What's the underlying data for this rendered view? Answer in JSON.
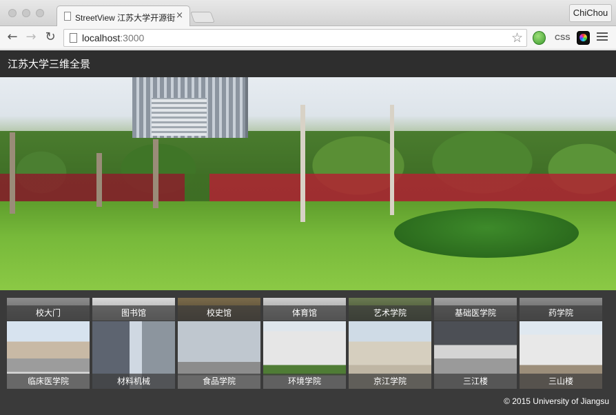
{
  "browser": {
    "tab_title": "StreetView 江苏大学开源街景",
    "tab_close": "×",
    "profile_name": "ChiChou",
    "url_host": "localhost",
    "url_port": ":3000",
    "back_glyph": "←",
    "forward_glyph": "→",
    "reload_glyph": "↻",
    "bookmark_glyph": "☆",
    "ext_css_label": "CSS"
  },
  "site": {
    "title": "江苏大学三维全景"
  },
  "locations": {
    "row1": [
      "校大门",
      "图书馆",
      "校史馆",
      "体育馆",
      "艺术学院",
      "基础医学院",
      "药学院"
    ],
    "row2": [
      "临床医学院",
      "材料机械",
      "食品学院",
      "环境学院",
      "京江学院",
      "三江楼",
      "三山楼"
    ]
  },
  "footer": {
    "copyright": "© 2015 University of Jiangsu"
  },
  "colors": {
    "header_bg": "#2e2e2e",
    "thumb_strip_bg": "#3a3a3a",
    "label_text": "#ffffff"
  }
}
